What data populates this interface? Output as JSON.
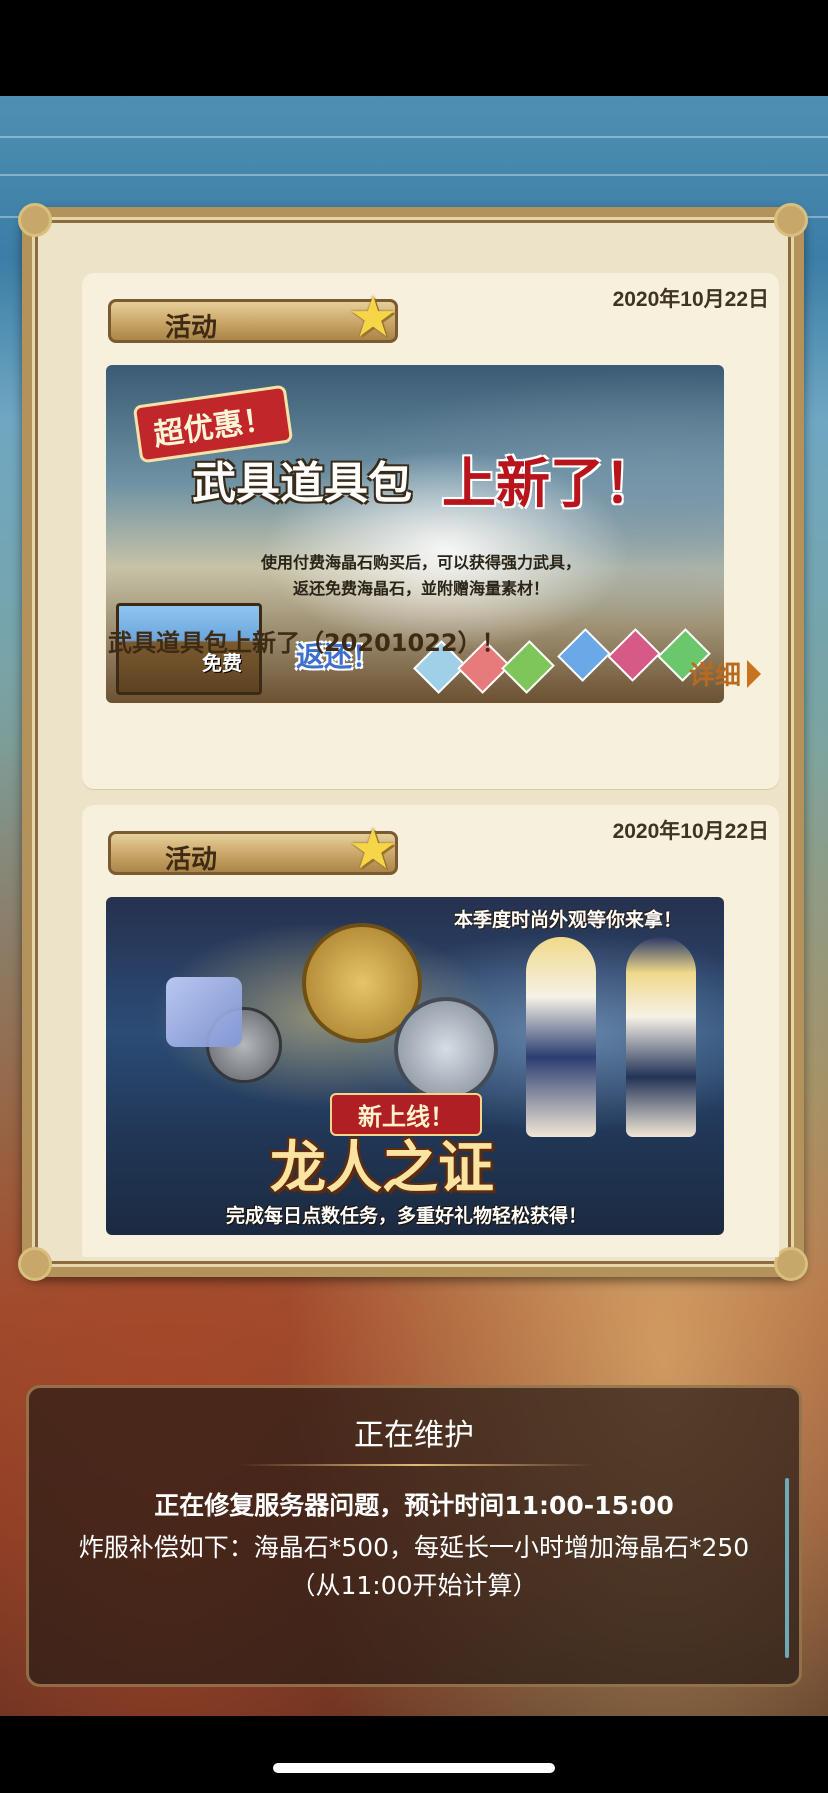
{
  "cards": [
    {
      "date": "2020年10月22日",
      "tag": "活动",
      "banner": {
        "badge": "超优惠！",
        "title_left": "武具道具包",
        "title_right": "上新了！",
        "desc_line1": "使用付费海晶石购买后，可以获得强力武具，",
        "desc_line2": "返还免费海晶石，並附赠海量素材！",
        "free_label": "免费",
        "return_label": "返还！"
      },
      "title": "武具道具包上新了（20201022）！",
      "detail_label": "详细"
    },
    {
      "date": "2020年10月22日",
      "tag": "活动",
      "banner": {
        "caption": "本季度时尚外观等你来拿！",
        "new_label": "新上线！",
        "title": "龙人之证",
        "subtitle": "完成每日点数任务，多重好礼物轻松获得！"
      }
    }
  ],
  "maintenance": {
    "title": "正在维护",
    "line1": "正在修复服务器问题，预计时间11:00-15:00",
    "line2": "炸服补偿如下：海晶石*500，每延长一小时增加海晶石*250",
    "line3": "（从11:00开始计算）"
  },
  "colors": {
    "frame": "#b3925c",
    "card": "#f6f0dd",
    "detail": "#b86b1e",
    "star": "#f6d646"
  },
  "icons": [
    "star-icon",
    "detail-arrow-icon",
    "gem-icon"
  ]
}
